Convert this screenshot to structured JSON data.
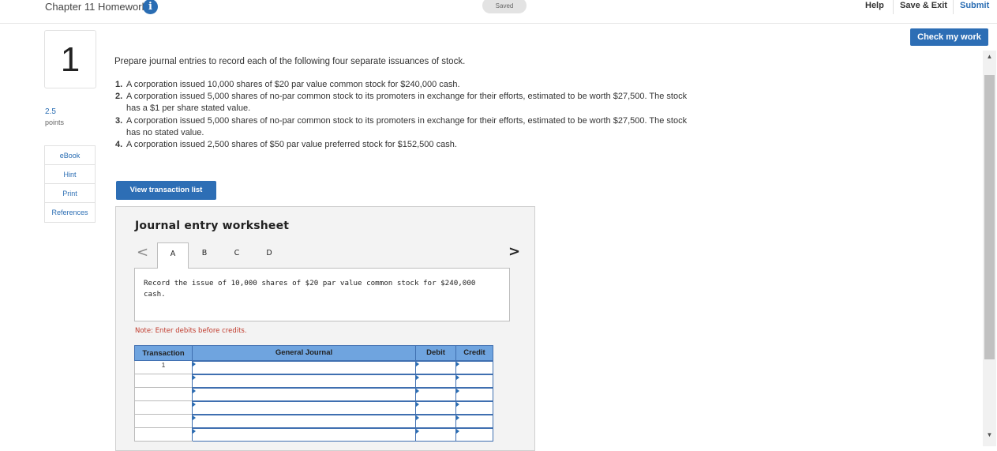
{
  "header": {
    "title": "Chapter 11 Homework",
    "info_icon": "i",
    "saved": "Saved",
    "help": "Help",
    "save_exit": "Save & Exit",
    "submit": "Submit"
  },
  "check_my_work": "Check my work",
  "question": {
    "number": "1",
    "points_value": "2.5",
    "points_label": "points",
    "prompt": "Prepare journal entries to record each of the following four separate issuances of stock.",
    "items": [
      {
        "num": "1.",
        "text": "A corporation issued 10,000 shares of $20 par value common stock for $240,000 cash."
      },
      {
        "num": "2.",
        "text": "A corporation issued 5,000 shares of no-par common stock to its promoters in exchange for their efforts, estimated to be worth $27,500. The stock has a $1 per share stated value."
      },
      {
        "num": "3.",
        "text": "A corporation issued 5,000 shares of no-par common stock to its promoters in exchange for their efforts, estimated to be worth $27,500. The stock has no stated value."
      },
      {
        "num": "4.",
        "text": "A corporation issued 2,500 shares of $50 par value preferred stock for $152,500 cash."
      }
    ]
  },
  "tools": [
    "eBook",
    "Hint",
    "Print",
    "References"
  ],
  "view_transaction_list": "View transaction list",
  "worksheet": {
    "title": "Journal entry worksheet",
    "prev_arrow": "<",
    "next_arrow": ">",
    "tabs": [
      "A",
      "B",
      "C",
      "D"
    ],
    "active_tab": "A",
    "instruction": "Record the issue of 10,000 shares of $20 par value common stock for $240,000 cash.",
    "note": "Note: Enter debits before credits.",
    "columns": [
      "Transaction",
      "General Journal",
      "Debit",
      "Credit"
    ],
    "rows": [
      {
        "transaction": "1",
        "general_journal": "",
        "debit": "",
        "credit": ""
      },
      {
        "transaction": "",
        "general_journal": "",
        "debit": "",
        "credit": ""
      },
      {
        "transaction": "",
        "general_journal": "",
        "debit": "",
        "credit": ""
      },
      {
        "transaction": "",
        "general_journal": "",
        "debit": "",
        "credit": ""
      },
      {
        "transaction": "",
        "general_journal": "",
        "debit": "",
        "credit": ""
      },
      {
        "transaction": "",
        "general_journal": "",
        "debit": "",
        "credit": ""
      }
    ]
  },
  "scrollbar": {
    "up": "▲",
    "down": "▼"
  }
}
